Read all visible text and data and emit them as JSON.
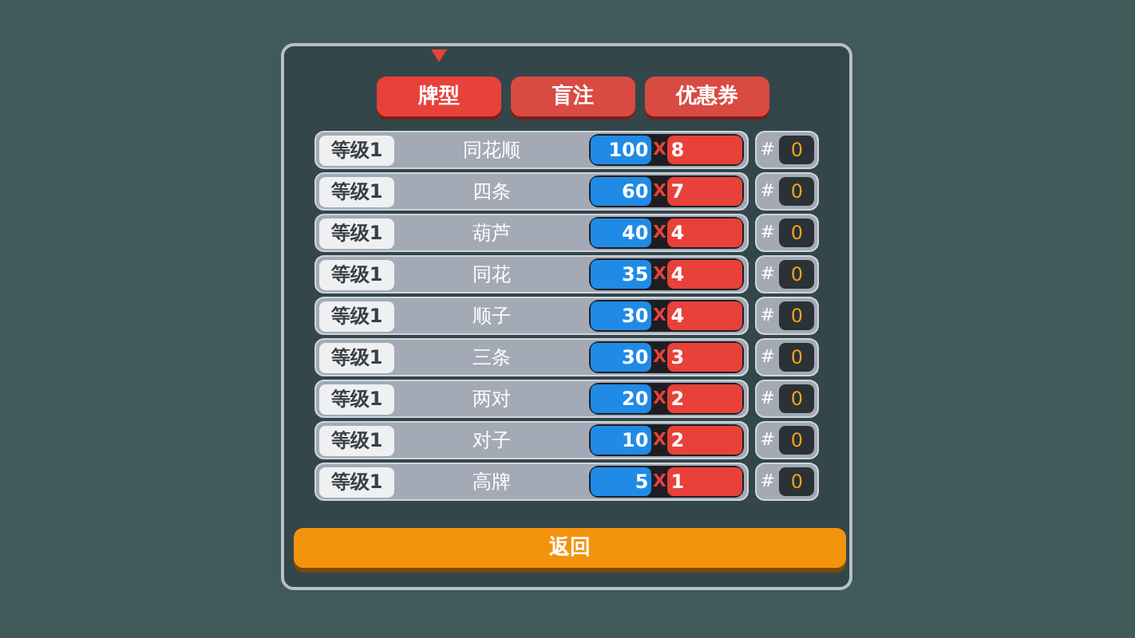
{
  "tabs": [
    {
      "label": "牌型",
      "selected": true
    },
    {
      "label": "盲注",
      "selected": false
    },
    {
      "label": "优惠券",
      "selected": false
    }
  ],
  "hands": [
    {
      "level": "等级1",
      "name": "同花顺",
      "chips": "100",
      "x": "X",
      "mult": "8",
      "hash": "#",
      "count": "0"
    },
    {
      "level": "等级1",
      "name": "四条",
      "chips": "60",
      "x": "X",
      "mult": "7",
      "hash": "#",
      "count": "0"
    },
    {
      "level": "等级1",
      "name": "葫芦",
      "chips": "40",
      "x": "X",
      "mult": "4",
      "hash": "#",
      "count": "0"
    },
    {
      "level": "等级1",
      "name": "同花",
      "chips": "35",
      "x": "X",
      "mult": "4",
      "hash": "#",
      "count": "0"
    },
    {
      "level": "等级1",
      "name": "顺子",
      "chips": "30",
      "x": "X",
      "mult": "4",
      "hash": "#",
      "count": "0"
    },
    {
      "level": "等级1",
      "name": "三条",
      "chips": "30",
      "x": "X",
      "mult": "3",
      "hash": "#",
      "count": "0"
    },
    {
      "level": "等级1",
      "name": "两对",
      "chips": "20",
      "x": "X",
      "mult": "2",
      "hash": "#",
      "count": "0"
    },
    {
      "level": "等级1",
      "name": "对子",
      "chips": "10",
      "x": "X",
      "mult": "2",
      "hash": "#",
      "count": "0"
    },
    {
      "level": "等级1",
      "name": "高牌",
      "chips": "5",
      "x": "X",
      "mult": "1",
      "hash": "#",
      "count": "0"
    }
  ],
  "back_button": "返回"
}
